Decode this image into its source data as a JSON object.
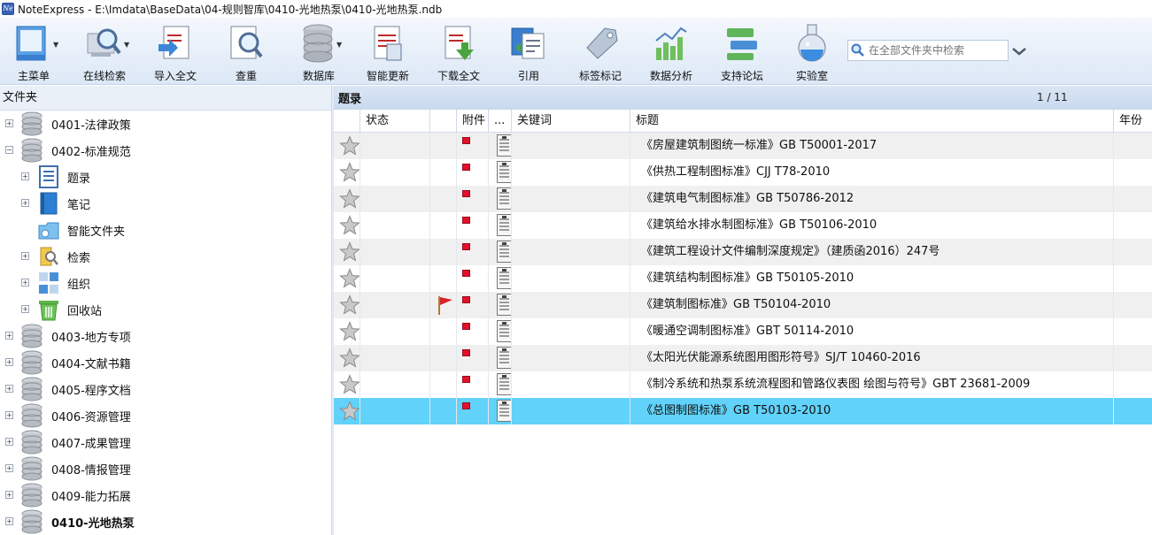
{
  "window": {
    "app_icon": "Ne",
    "title": "NoteExpress - E:\\Imdata\\BaseData\\04-规则智库\\0410-光地热泵\\0410-光地热泵.ndb"
  },
  "toolbar": {
    "buttons": [
      {
        "label": "主菜单",
        "icon": "main-menu-icon"
      },
      {
        "label": "在线检索",
        "icon": "online-search-icon"
      },
      {
        "label": "导入全文",
        "icon": "import-fulltext-icon"
      },
      {
        "label": "查重",
        "icon": "duplicate-check-icon"
      },
      {
        "label": "数据库",
        "icon": "database-icon"
      },
      {
        "label": "智能更新",
        "icon": "smart-update-icon"
      },
      {
        "label": "下载全文",
        "icon": "download-fulltext-icon"
      },
      {
        "label": "引用",
        "icon": "cite-icon"
      },
      {
        "label": "标签标记",
        "icon": "tag-icon"
      },
      {
        "label": "数据分析",
        "icon": "data-analysis-icon"
      },
      {
        "label": "支持论坛",
        "icon": "forum-icon"
      },
      {
        "label": "实验室",
        "icon": "lab-flask-icon"
      }
    ],
    "search_placeholder": "在全部文件夹中检索"
  },
  "left_panel": {
    "header": "文件夹",
    "items": [
      {
        "label": "0401-法律政策",
        "level": 0,
        "expander": "+"
      },
      {
        "label": "0402-标准规范",
        "level": 0,
        "expander": "−"
      },
      {
        "label": "题录",
        "level": 1,
        "expander": "+",
        "icon": "records-icon"
      },
      {
        "label": "笔记",
        "level": 1,
        "expander": "+",
        "icon": "notes-icon"
      },
      {
        "label": "智能文件夹",
        "level": 1,
        "expander": "",
        "icon": "smart-folder-icon"
      },
      {
        "label": "检索",
        "level": 1,
        "expander": "+",
        "icon": "search-folder-icon"
      },
      {
        "label": "组织",
        "level": 1,
        "expander": "+",
        "icon": "organize-icon"
      },
      {
        "label": "回收站",
        "level": 1,
        "expander": "+",
        "icon": "recycle-bin-icon"
      },
      {
        "label": "0403-地方专项",
        "level": 0,
        "expander": "+"
      },
      {
        "label": "0404-文献书籍",
        "level": 0,
        "expander": "+"
      },
      {
        "label": "0405-程序文档",
        "level": 0,
        "expander": "+"
      },
      {
        "label": "0406-资源管理",
        "level": 0,
        "expander": "+"
      },
      {
        "label": "0407-成果管理",
        "level": 0,
        "expander": "+"
      },
      {
        "label": "0408-情报管理",
        "level": 0,
        "expander": "+"
      },
      {
        "label": "0409-能力拓展",
        "level": 0,
        "expander": "+"
      },
      {
        "label": "0410-光地热泵",
        "level": 0,
        "expander": "+",
        "bold": true
      }
    ]
  },
  "right_panel": {
    "header": "题录",
    "page_indicator": "1 / 11",
    "columns": [
      "状态",
      "附件",
      "...",
      "关键词",
      "标题",
      "年份"
    ],
    "rows": [
      {
        "title": "《房屋建筑制图统一标准》GB T50001-2017",
        "flag": false
      },
      {
        "title": "《供热工程制图标准》CJJ T78-2010",
        "flag": false
      },
      {
        "title": "《建筑电气制图标准》GB T50786-2012",
        "flag": false
      },
      {
        "title": "《建筑给水排水制图标准》GB T50106-2010",
        "flag": false
      },
      {
        "title": "《建筑工程设计文件编制深度规定》（建质函2016）247号",
        "flag": false
      },
      {
        "title": "《建筑结构制图标准》GB T50105-2010",
        "flag": false
      },
      {
        "title": "《建筑制图标准》GB T50104-2010",
        "flag": true
      },
      {
        "title": "《暖通空调制图标准》GBT 50114-2010",
        "flag": false
      },
      {
        "title": "《太阳光伏能源系统图用图形符号》SJ/T 10460-2016",
        "flag": false
      },
      {
        "title": "《制冷系统和热泵系统流程图和管路仪表图 绘图与符号》GBT 23681-2009",
        "flag": false
      },
      {
        "title": "《总图制图标准》GB T50103-2010",
        "flag": false,
        "selected": true
      }
    ]
  },
  "colors": {
    "selected_row": "#61d2f9",
    "attachment_marker": "#e0112b",
    "flag": "#d8232a",
    "toolbar_bg": "#dce8f6"
  }
}
